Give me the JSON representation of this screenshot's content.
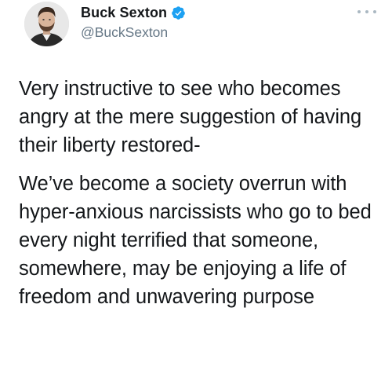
{
  "author": {
    "display_name": "Buck Sexton",
    "handle": "@BuckSexton",
    "verified": true
  },
  "icons": {
    "avatar": "avatar",
    "verified": "verified-badge-icon",
    "more": "more-options-icon"
  },
  "colors": {
    "text": "#14171a",
    "handle": "#657786",
    "verified": "#1da1f2"
  },
  "tweet": {
    "paragraphs": [
      "Very instructive to see who becomes angry at the mere suggestion of having their liberty restored-",
      "We’ve become a society overrun with hyper-anxious narcissists who go to bed every night terrified that someone, somewhere, may be enjoying a life of freedom and unwavering purpose"
    ]
  }
}
